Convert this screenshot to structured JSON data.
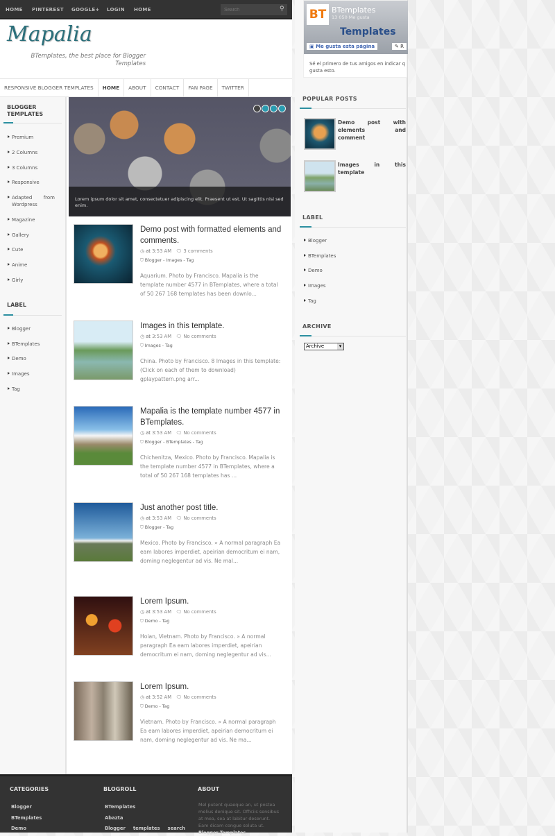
{
  "topbar": {
    "links": [
      "HOME",
      "PINTEREST",
      "GOOGLE+",
      "LOGIN",
      "HOME"
    ],
    "search_placeholder": "Search"
  },
  "header": {
    "logo": "Mapalia",
    "tagline": "BTemplates, the best place for Blogger Templates"
  },
  "mainnav": {
    "items": [
      "RESPONSIVE BLOGGER TEMPLATES",
      "HOME",
      "ABOUT",
      "CONTACT",
      "FAN PAGE",
      "TWITTER"
    ],
    "active": "HOME"
  },
  "left_sidebar": {
    "templates_title": "BLOGGER TEMPLATES",
    "templates": [
      "Premium",
      "2 Columns",
      "3 Columns",
      "Responsive",
      "Adapted from Wordpress",
      "Magazine",
      "Gallery",
      "Cute",
      "Anime",
      "Girly"
    ],
    "label_title": "LABEL",
    "labels": [
      "Blogger",
      "BTemplates",
      "Demo",
      "Images",
      "Tag"
    ]
  },
  "slider": {
    "caption": "Lorem ipsum dolor sit amet, consectetuer adipiscing elit. Praesent ut est. Ut sagittis nisi sed enim.",
    "slide_count": 4,
    "active_slide": 1
  },
  "posts": [
    {
      "title": "Demo post with formatted elements and comments.",
      "time": "3:53 AM",
      "comments": "3 comments",
      "labels": "Blogger - Images - Tag",
      "excerpt": "Aquarium. Photo by Francisco. Mapalia is the template number 4577 in BTemplates, where a total of 50 267 168 templates has been downlo..."
    },
    {
      "title": "Images in this template.",
      "time": "3:53 AM",
      "comments": "No comments",
      "labels": "Images - Tag",
      "excerpt": "China. Photo by Francisco. 8 Images in this template: (Click on each of them to download) gplaypattern.png arr..."
    },
    {
      "title": "Mapalia is the template number 4577 in BTemplates.",
      "time": "3:53 AM",
      "comments": "No comments",
      "labels": "Blogger - BTemplates - Tag",
      "excerpt": "Chichenitza, Mexico. Photo by Francisco. Mapalia is the template number 4577 in BTemplates, where a total of 50 267 168 templates has ..."
    },
    {
      "title": "Just another post title.",
      "time": "3:53 AM",
      "comments": "No comments",
      "labels": "Blogger - Tag",
      "excerpt": "Mexico. Photo by Francisco. » A normal paragraph Ea eam labores imperdiet, apeirian democritum ei nam, doming neglegentur ad vis. Ne mal..."
    },
    {
      "title": "Lorem Ipsum.",
      "time": "3:53 AM",
      "comments": "No comments",
      "labels": "Demo - Tag",
      "excerpt": "Hoian, Vietnam. Photo by Francisco. » A normal paragraph Ea eam labores imperdiet, apeirian democritum ei nam, doming neglegentur ad vis..."
    },
    {
      "title": "Lorem Ipsum.",
      "time": "3:52 AM",
      "comments": "No comments",
      "labels": "Demo - Tag",
      "excerpt": "Vietnam. Photo by Francisco. » A normal paragraph Ea eam labores imperdiet, apeirian democritum ei nam, doming neglegentur ad vis. Ne ma..."
    }
  ],
  "post_meta_prefix": "at",
  "right_sidebar": {
    "fb": {
      "logo": "BT",
      "name": "BTemplates",
      "likes": "13 050 Me gusta",
      "brand": "Templates",
      "like_button": "Me gusta esta página",
      "share_button": "R",
      "text": "Sé el primero de tus amigos en indicar q gusta esto."
    },
    "popular_title": "POPULAR POSTS",
    "popular": [
      "Demo post with elements and comment",
      "Images in this template"
    ],
    "label_title": "LABEL",
    "labels": [
      "Blogger",
      "BTemplates",
      "Demo",
      "Images",
      "Tag"
    ],
    "archive_title": "ARCHIVE",
    "archive_value": "Archive"
  },
  "footer": {
    "categories_title": "CATEGORIES",
    "categories": [
      "Blogger",
      "BTemplates",
      "Demo"
    ],
    "blogroll_title": "BLOGROLL",
    "blogroll": [
      "BTemplates",
      "Abazta",
      "Blogger templates search"
    ],
    "about_title": "ABOUT",
    "about_text": "Mel putent quaeque an, ut postea melius denique sit. Officiis sensibus at mea, sea at labitur deserunt. Eam dicam congue soluta ut.",
    "about_link": "Blogger Templates"
  },
  "colors": {
    "accent": "#2b8fa0",
    "topbar": "#333333",
    "logo": "#2b6f7a"
  }
}
